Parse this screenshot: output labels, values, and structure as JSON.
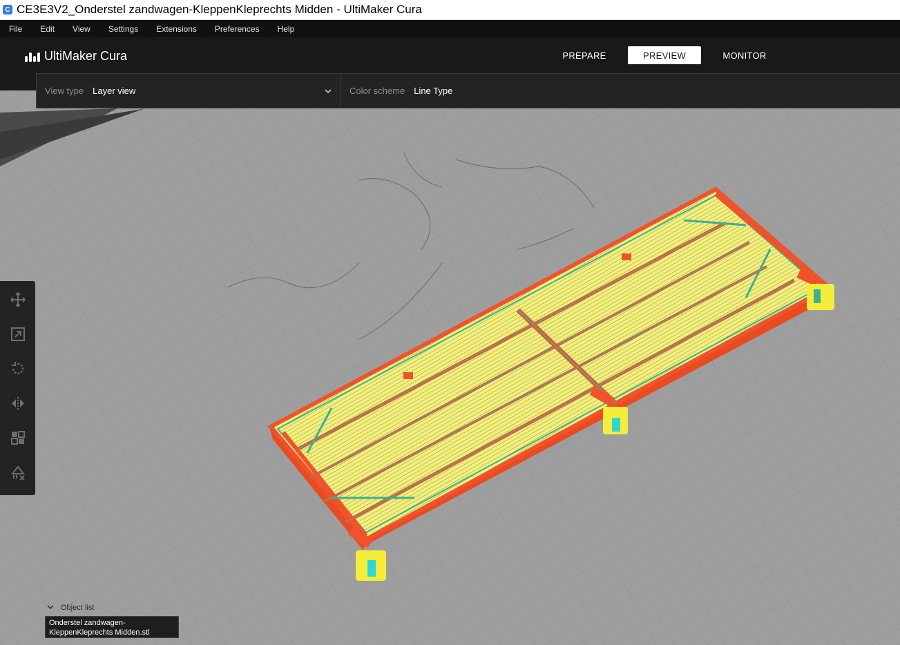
{
  "window": {
    "title": "CE3E3V2_Onderstel zandwagen-KleppenKleprechts Midden - UltiMaker Cura",
    "app_icon_letter": "C"
  },
  "menu": [
    "File",
    "Edit",
    "View",
    "Settings",
    "Extensions",
    "Preferences",
    "Help"
  ],
  "header": {
    "logo_text": "UltiMaker Cura",
    "stages": [
      {
        "label": "PREPARE",
        "active": false
      },
      {
        "label": "PREVIEW",
        "active": true
      },
      {
        "label": "MONITOR",
        "active": false
      }
    ]
  },
  "viewbar": {
    "view_type_label": "View type",
    "view_type_value": "Layer view",
    "color_scheme_label": "Color scheme",
    "color_scheme_value": "Line Type"
  },
  "toolbar": {
    "tools": [
      "move-icon",
      "scale-icon",
      "rotate-icon",
      "mirror-icon",
      "per-model-settings-icon",
      "support-blocker-icon"
    ]
  },
  "object_list": {
    "header": "Object list",
    "items": [
      "Onderstel zandwagen-KleppenKleprechts Midden.stl"
    ]
  },
  "colors": {
    "infill_yellow": "#f2f07a",
    "wall_outer_red": "#f0532b",
    "wall_inner_teal": "#3fae94",
    "support_cyan": "#2fd6d6",
    "header_bg": "#191919",
    "buildplate_gray": "#9c9c9c"
  }
}
